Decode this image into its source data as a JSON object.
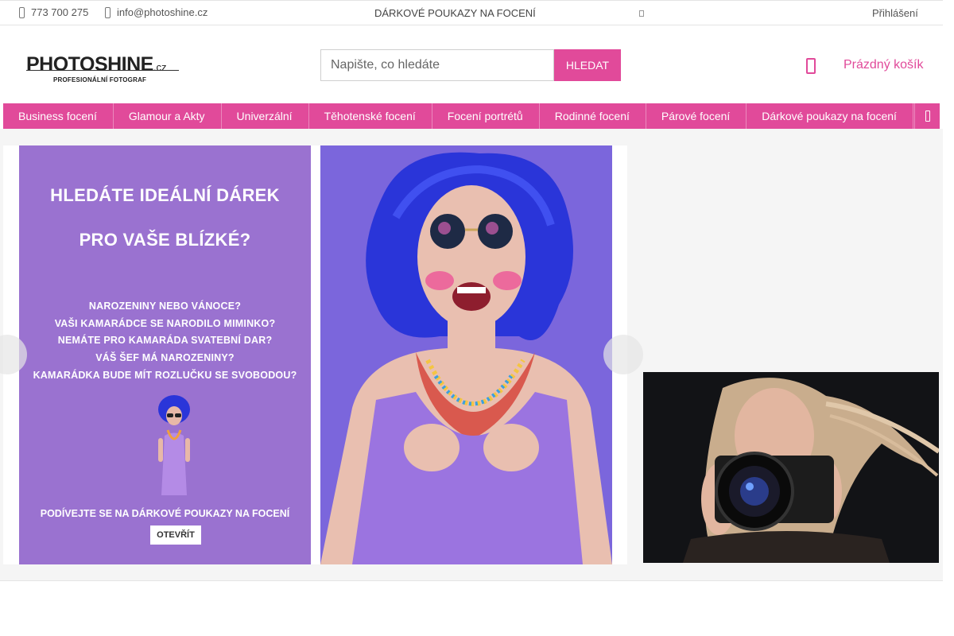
{
  "topbar": {
    "phone": "773 700 275",
    "email": "info@photoshine.cz",
    "gift_link": "DÁRKOVÉ POUKAZY NA FOCENÍ",
    "login": "Přihlášení"
  },
  "header": {
    "logo_brand": "PHOTOSHINE",
    "logo_tld": ".cz",
    "logo_tagline": "PROFESIONÁLNÍ FOTOGRAF",
    "search_placeholder": "Napište, co hledáte",
    "search_button": "HLEDAT",
    "cart_label": "Prázdný košík"
  },
  "nav": {
    "items": [
      "Business focení",
      "Glamour a Akty",
      "Univerzální",
      "Těhotenské focení",
      "Focení portrétů",
      "Rodinné focení",
      "Párové focení",
      "Dárkové poukazy na focení"
    ]
  },
  "banner": {
    "heading_1": "HLEDÁTE IDEÁLNÍ DÁREK",
    "heading_2": "PRO VAŠE BLÍZKÉ?",
    "questions": [
      "NAROZENINY NEBO VÁNOCE?",
      "VAŠI KAMARÁDCE SE NARODILO MIMINKO?",
      "NEMÁTE PRO KAMARÁDA SVATEBNÍ DAR?",
      "VÁŠ ŠEF MÁ NAROZENINY?",
      "KAMARÁDKA BUDE MÍT ROZLUČKU SE SVOBODOU?"
    ],
    "cta_text": "PODÍVEJTE SE NA DÁRKOVÉ POUKAZY NA FOCENÍ",
    "open_button": "OTEVŘÍT"
  },
  "colors": {
    "accent": "#e14a9a",
    "promo_purple": "#9a72d0",
    "photo_bg": "#7b66dc",
    "wig_blue": "#2a35d9"
  }
}
